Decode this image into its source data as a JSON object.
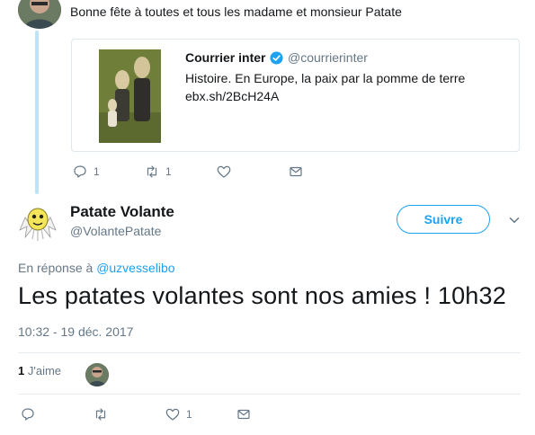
{
  "previous_tweet": {
    "text": "Bonne fête à toutes et tous les madame et monsieur Patate",
    "avatar_icon": "user-avatar-icon",
    "quoted": {
      "name": "Courrier inter",
      "handle": "@courrierinter",
      "verified_icon": "verified-badge-icon",
      "line1": "Histoire. En Europe, la paix par la pomme de terre",
      "line2": "ebx.sh/2BcH24A"
    },
    "actions": {
      "reply_count": "1",
      "retweet_count": "1",
      "like_count": "",
      "dm_count": ""
    }
  },
  "main_tweet": {
    "name": "Patate Volante",
    "handle": "@VolantePatate",
    "follow_label": "Suivre",
    "reply_prefix": "En réponse à",
    "reply_to": "@uzvesselibo",
    "text": "Les patates volantes sont nos amies ! 10h32",
    "timestamp": "10:32 - 19 déc. 2017",
    "likes_count": "1",
    "likes_label": "J'aime",
    "actions": {
      "reply_count": "",
      "retweet_count": "",
      "like_count": "1",
      "dm_count": ""
    }
  },
  "colors": {
    "accent": "#1da1f2",
    "muted": "#657786",
    "thread_line": "#bfe3f6",
    "divider": "#e6ecf0"
  }
}
